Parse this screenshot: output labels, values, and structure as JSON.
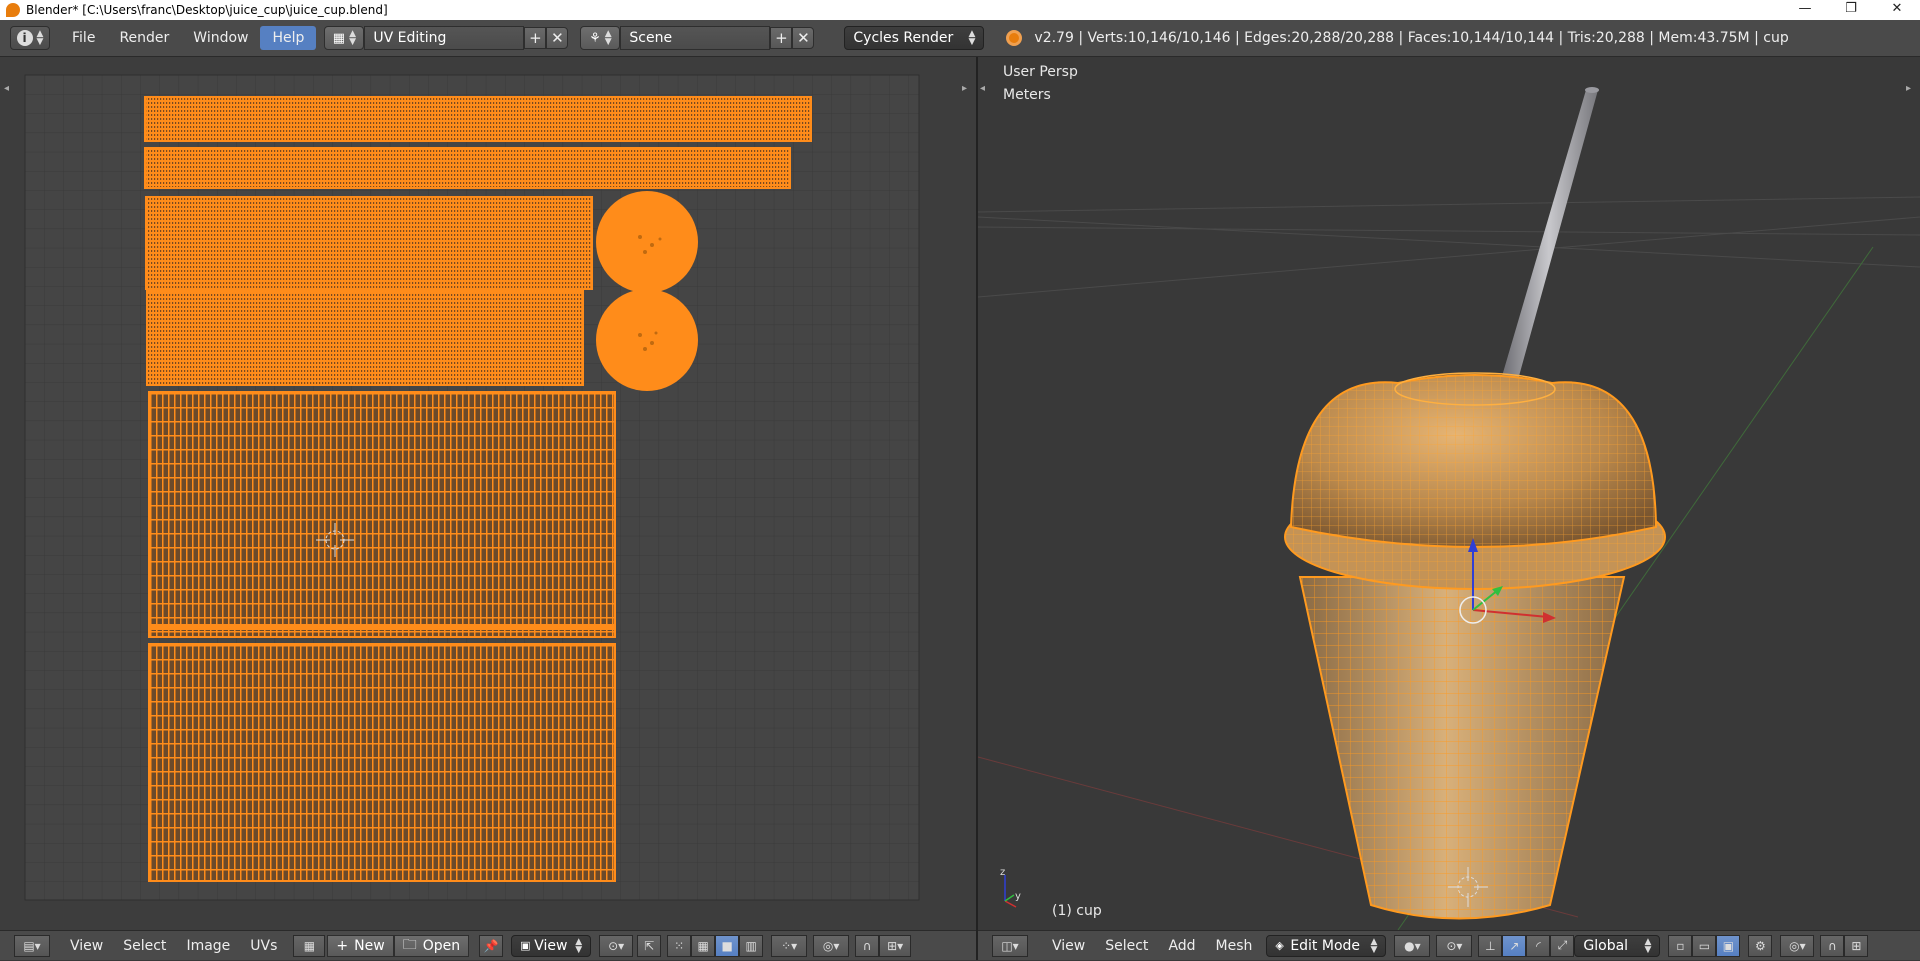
{
  "window": {
    "title": "Blender* [C:\\Users\\franc\\Desktop\\juice_cup\\juice_cup.blend]",
    "controls": [
      "—",
      "❐",
      "✕"
    ]
  },
  "info_header": {
    "menus": [
      "File",
      "Render",
      "Window",
      "Help"
    ],
    "active_menu": "Help",
    "screen_layout": "UV Editing",
    "scene": "Scene",
    "render_engine": "Cycles Render",
    "stats": "v2.79 | Verts:10,146/10,146 | Edges:20,288/20,288 | Faces:10,144/10,144 | Tris:20,288 | Mem:43.75M | cup"
  },
  "viewport": {
    "view_label": "User Persp",
    "units_label": "Meters",
    "object_label": "(1) cup"
  },
  "uv_editor_header": {
    "menus": [
      "View",
      "Select",
      "Image",
      "UVs"
    ],
    "new_label": "New",
    "open_label": "Open",
    "view_dropdown": "View"
  },
  "viewport_header": {
    "menus": [
      "View",
      "Select",
      "Add",
      "Mesh"
    ],
    "mode": "Edit Mode",
    "orientation": "Global"
  },
  "colors": {
    "uv_orange": "#ff8c1a",
    "select_blue": "#5680c2",
    "grid_bg": "#454545"
  }
}
